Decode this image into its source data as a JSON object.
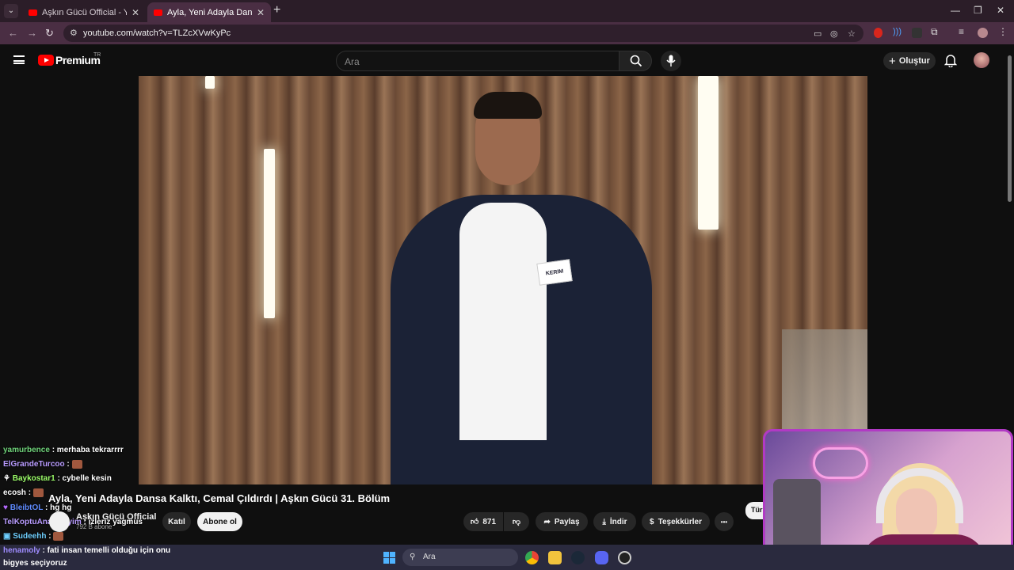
{
  "browser": {
    "tabs": [
      {
        "title": "Aşkın Gücü Official - YouTube",
        "active": false
      },
      {
        "title": "Ayla, Yeni Adayla Dansa Kalktı, C",
        "active": true
      }
    ],
    "url": "youtube.com/watch?v=TLZcXVwKyPc",
    "window_controls": [
      "—",
      "❐",
      "✕"
    ]
  },
  "youtube": {
    "brand": "Premium",
    "country": "TR",
    "search_placeholder": "Ara",
    "create_label": "Oluştur",
    "video": {
      "name_badge": "KERIM",
      "title": "Ayla, Yeni Adayla Dansa Kalktı, Cemal Çıldırdı | Aşkın Gücü 31. Bölüm",
      "channel": "Aşkın Gücü Official",
      "subscribers": "792 B abone",
      "join_label": "Katıl",
      "subscribe_label": "Abone ol",
      "likes": "871",
      "share_label": "Paylaş",
      "download_label": "İndir",
      "thanks_label": "Teşekkürler",
      "more_label": "•••",
      "side_button": "Tür"
    }
  },
  "chat": [
    {
      "user": "yamurbence",
      "msg": ": merhaba tekrarrrr",
      "color": "#6fd37a"
    },
    {
      "user": "ElGrandeTurcoo",
      "msg": ":",
      "color": "#b99cff",
      "emote": true
    },
    {
      "user": "Baykostar1",
      "msg": ": cybelle kesin",
      "color": "#9dff6a",
      "badge": true
    },
    {
      "user": "ecosh",
      "msg": ":",
      "color": "#ffffff",
      "emote": true
    },
    {
      "user": "BleibtOL",
      "msg": ": hg hg",
      "color": "#5f8bff",
      "badge": true
    },
    {
      "user": "TelKoptuAnamkeyim",
      "msg": ": izleriz yagmus",
      "color": "#b99cff"
    },
    {
      "user": "Sudeehh",
      "msg": ":",
      "color": "#6fd0ff",
      "emote": true,
      "badge": true
    },
    {
      "user": "henamoly",
      "msg": ": fati insan temelli olduğu için onu",
      "color": "#9f8cff"
    },
    {
      "user": "",
      "msg": "bigyes seçiyoruz",
      "color": "#ffffff"
    }
  ],
  "taskbar": {
    "search_label": "Ara",
    "apps": [
      "chrome-icon",
      "file-explorer-icon",
      "steam-icon",
      "discord-icon",
      "obs-icon"
    ]
  },
  "colors": {
    "tab_bg": "#2b1d28",
    "toolbar_bg": "#4a2e43",
    "yt_red": "#ff0000",
    "webcam_border": "#b13ac4"
  }
}
